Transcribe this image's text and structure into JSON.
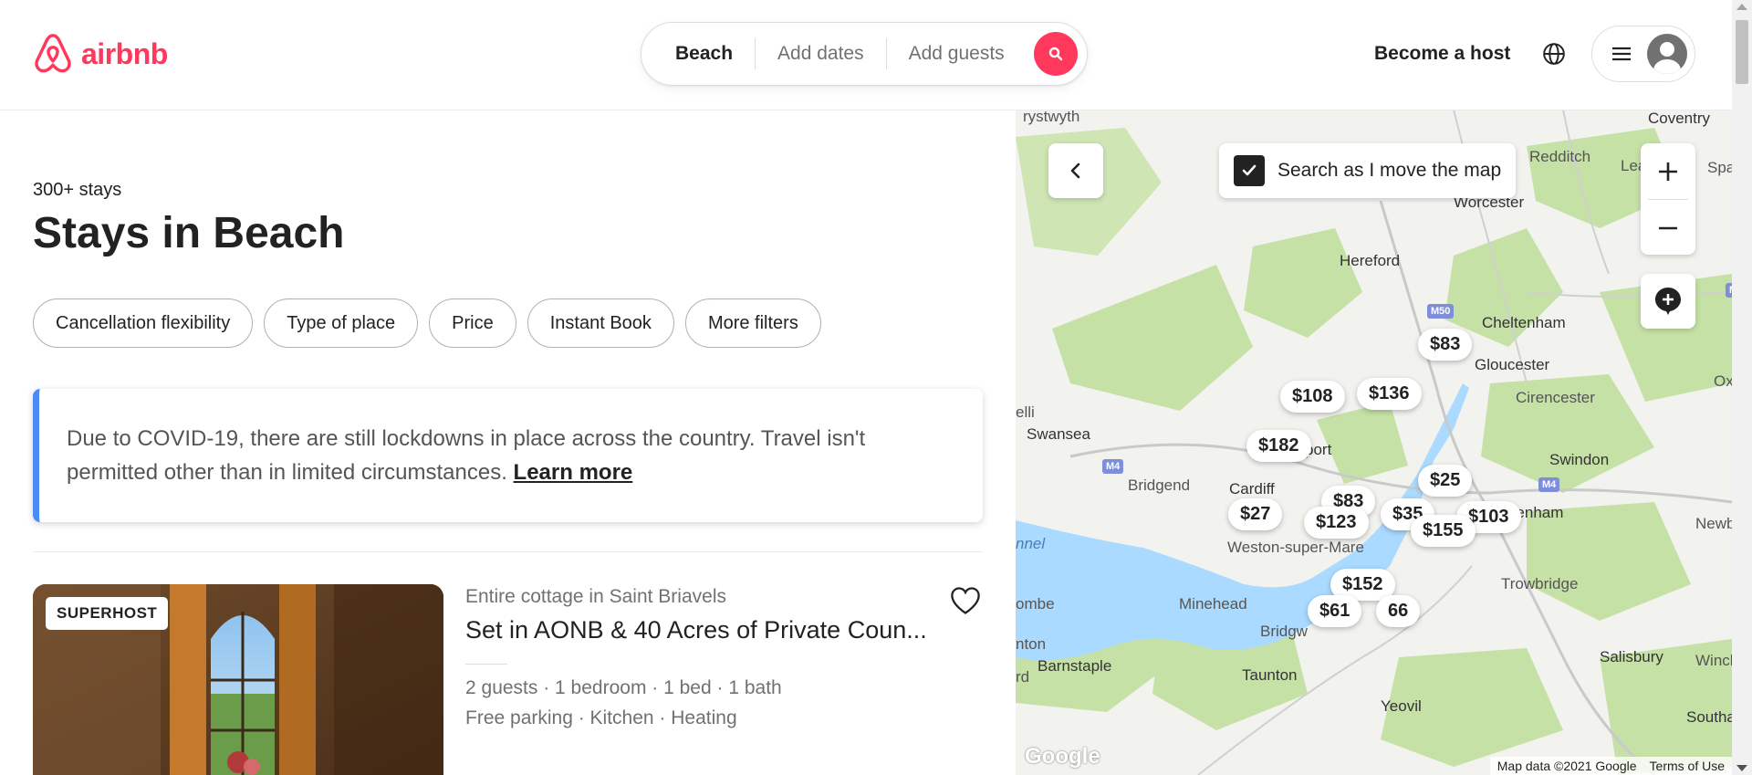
{
  "header": {
    "logo_text": "airbnb",
    "search": {
      "location": "Beach",
      "dates_placeholder": "Add dates",
      "guests_placeholder": "Add guests"
    },
    "become_host": "Become a host"
  },
  "results": {
    "count": "300+ stays",
    "title": "Stays in Beach"
  },
  "filters": [
    "Cancellation flexibility",
    "Type of place",
    "Price",
    "Instant Book",
    "More filters"
  ],
  "alert": {
    "text": "Due to COVID-19, there are still lockdowns in place across the country. Travel isn't permitted other than in limited circumstances.",
    "link": "Learn more"
  },
  "listing": {
    "badge": "SUPERHOST",
    "type": "Entire cottage in Saint Briavels",
    "title": "Set in AONB & 40 Acres of Private Coun...",
    "details": "2 guests · 1 bedroom · 1 bed · 1 bath",
    "amenities": "Free parking · Kitchen · Heating"
  },
  "map": {
    "search_as_move": "Search as I move the map",
    "search_as_move_checked": true,
    "places": [
      "rystwyth",
      "Coventry",
      "Redditch",
      "Leam",
      "Spa",
      "Worcester",
      "Hereford",
      "Cheltenham",
      "Gloucester",
      "Ox",
      "Cirencester",
      "elli",
      "Swansea",
      "Swindon",
      "Bridgend",
      "Cardiff",
      "port",
      "Chippenham",
      "Newb",
      "Weston-super-Mare",
      "nnel",
      "Trowbridge",
      "ombe",
      "Minehead",
      "Bridgw",
      "nton",
      "Barnstaple",
      "Taunton",
      "Salisbury",
      "Winche",
      "rd",
      "Yeovil",
      "Southamp"
    ],
    "motorways": [
      "M50",
      "M4",
      "M4",
      "M4"
    ],
    "prices": [
      "$83",
      "$108",
      "$136",
      "$182",
      "$25",
      "$83",
      "$27",
      "$123",
      "$35",
      "$103",
      "$155",
      "$152",
      "66",
      "$61"
    ],
    "attribution": "Map data ©2021 Google",
    "terms": "Terms of Use",
    "google_logo": "Google"
  },
  "colors": {
    "brand": "#FF385C",
    "alert_accent": "#4C8BF5",
    "map_water": "#AADAFF",
    "map_park": "#C5E1A5"
  }
}
